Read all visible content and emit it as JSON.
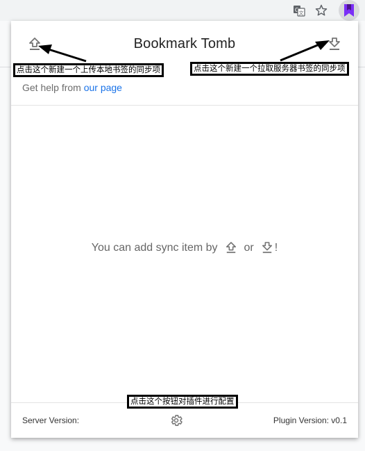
{
  "browser": {
    "toolbar_icons": [
      "translate-icon",
      "star-icon",
      "bookmark-extension-icon"
    ],
    "extension_accent": "#7b2ff7"
  },
  "popup": {
    "title": "Bookmark Tomb",
    "help_prefix": "Get help from ",
    "help_link": "our page",
    "empty": {
      "before": "You can add sync item by",
      "middle": "or",
      "after": "!"
    },
    "footer": {
      "server_version": "Server Version:",
      "plugin_version": "Plugin Version: v0.1"
    }
  },
  "annotations": {
    "upload_note": "点击这个新建一个上传本地书签的同步项",
    "download_note": "点击这个新建一个拉取服务器书签的同步项",
    "settings_note": "点击这个按钮对插件进行配置"
  },
  "colors": {
    "link": "#1a73e8",
    "icon_gray": "#757575"
  }
}
